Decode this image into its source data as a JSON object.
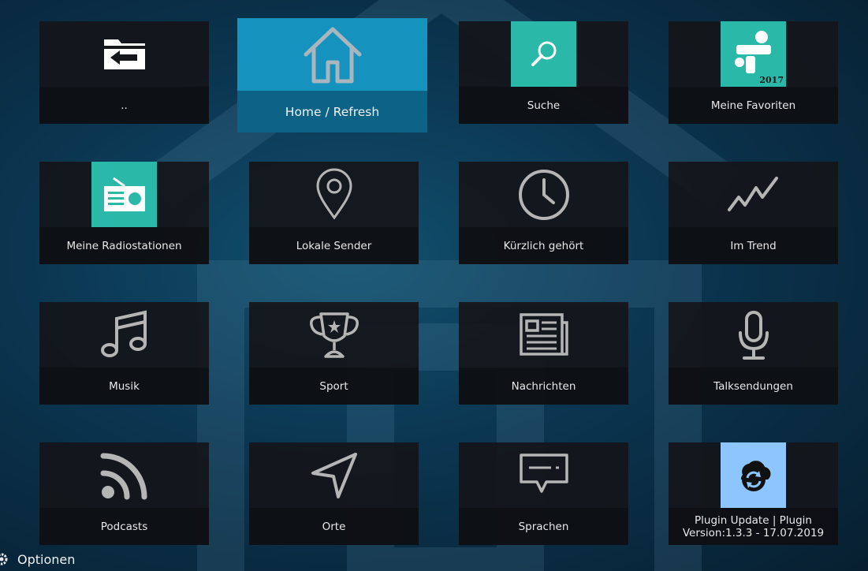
{
  "tiles": [
    {
      "label": "..",
      "icon": "back-folder-icon"
    },
    {
      "label": "Home / Refresh",
      "icon": "home-icon"
    },
    {
      "label": "Suche",
      "icon": "search-icon"
    },
    {
      "label": "Meine Favoriten",
      "icon": "favorites-thumbnail-icon",
      "thumb_text": "2017"
    },
    {
      "label": "Meine Radiostationen",
      "icon": "radio-icon"
    },
    {
      "label": "Lokale Sender",
      "icon": "map-pin-icon"
    },
    {
      "label": "Kürzlich gehört",
      "icon": "clock-icon"
    },
    {
      "label": "Im Trend",
      "icon": "trend-icon"
    },
    {
      "label": "Musik",
      "icon": "music-note-icon"
    },
    {
      "label": "Sport",
      "icon": "trophy-icon"
    },
    {
      "label": "Nachrichten",
      "icon": "newspaper-icon"
    },
    {
      "label": "Talksendungen",
      "icon": "microphone-icon"
    },
    {
      "label": "Podcasts",
      "icon": "podcast-rss-icon"
    },
    {
      "label": "Orte",
      "icon": "navigation-arrow-icon"
    },
    {
      "label": "Sprachen",
      "icon": "speech-bubble-icon"
    },
    {
      "label": "Plugin Update | Plugin Version:1.3.3 - 17.07.2019",
      "icon": "cloud-sync-icon"
    }
  ],
  "footer": {
    "options_label": "Optionen"
  },
  "colors": {
    "focus_tile": "#1593be",
    "teal_thumb": "#2ab9a8",
    "update_thumb": "#8dc6ff",
    "background": "#0b3550"
  }
}
